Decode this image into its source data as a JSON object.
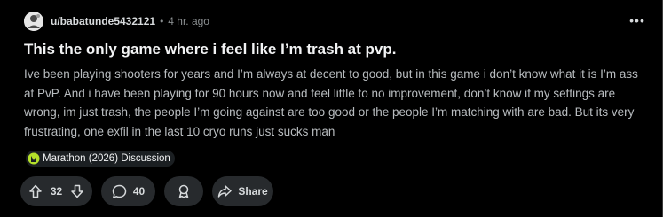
{
  "post": {
    "username": "u/babatunde5432121",
    "separator": "•",
    "time": "4 hr. ago",
    "more_label": "•••",
    "title": "This the only game where i feel like I’m trash at pvp.",
    "body": "Ive been playing shooters for years and I’m always at decent to good, but in this game i don’t know what it is I’m ass at PvP. And i have been playing for 90 hours now and feel little to no improvement, don’t know if my settings are wrong, im just trash, the people I’m going against are too good or the people I’m matching with are bad. But its very frustrating, one exfil in the last 10 cryo runs just sucks man",
    "flair": "Marathon (2026) Discussion"
  },
  "actions": {
    "vote_count": "32",
    "comment_count": "40",
    "share_label": "Share"
  },
  "icons": {
    "avatar": "avatar-icon",
    "more": "more-options-icon",
    "flair": "marathon-logo-icon",
    "upvote": "upvote-icon",
    "downvote": "downvote-icon",
    "comment": "comment-icon",
    "award": "award-icon",
    "share": "share-icon"
  },
  "colors": {
    "background": "#000000",
    "pill_background": "#272a2d",
    "flair_icon": "#b4e02a",
    "text_muted": "#8b8f91"
  }
}
